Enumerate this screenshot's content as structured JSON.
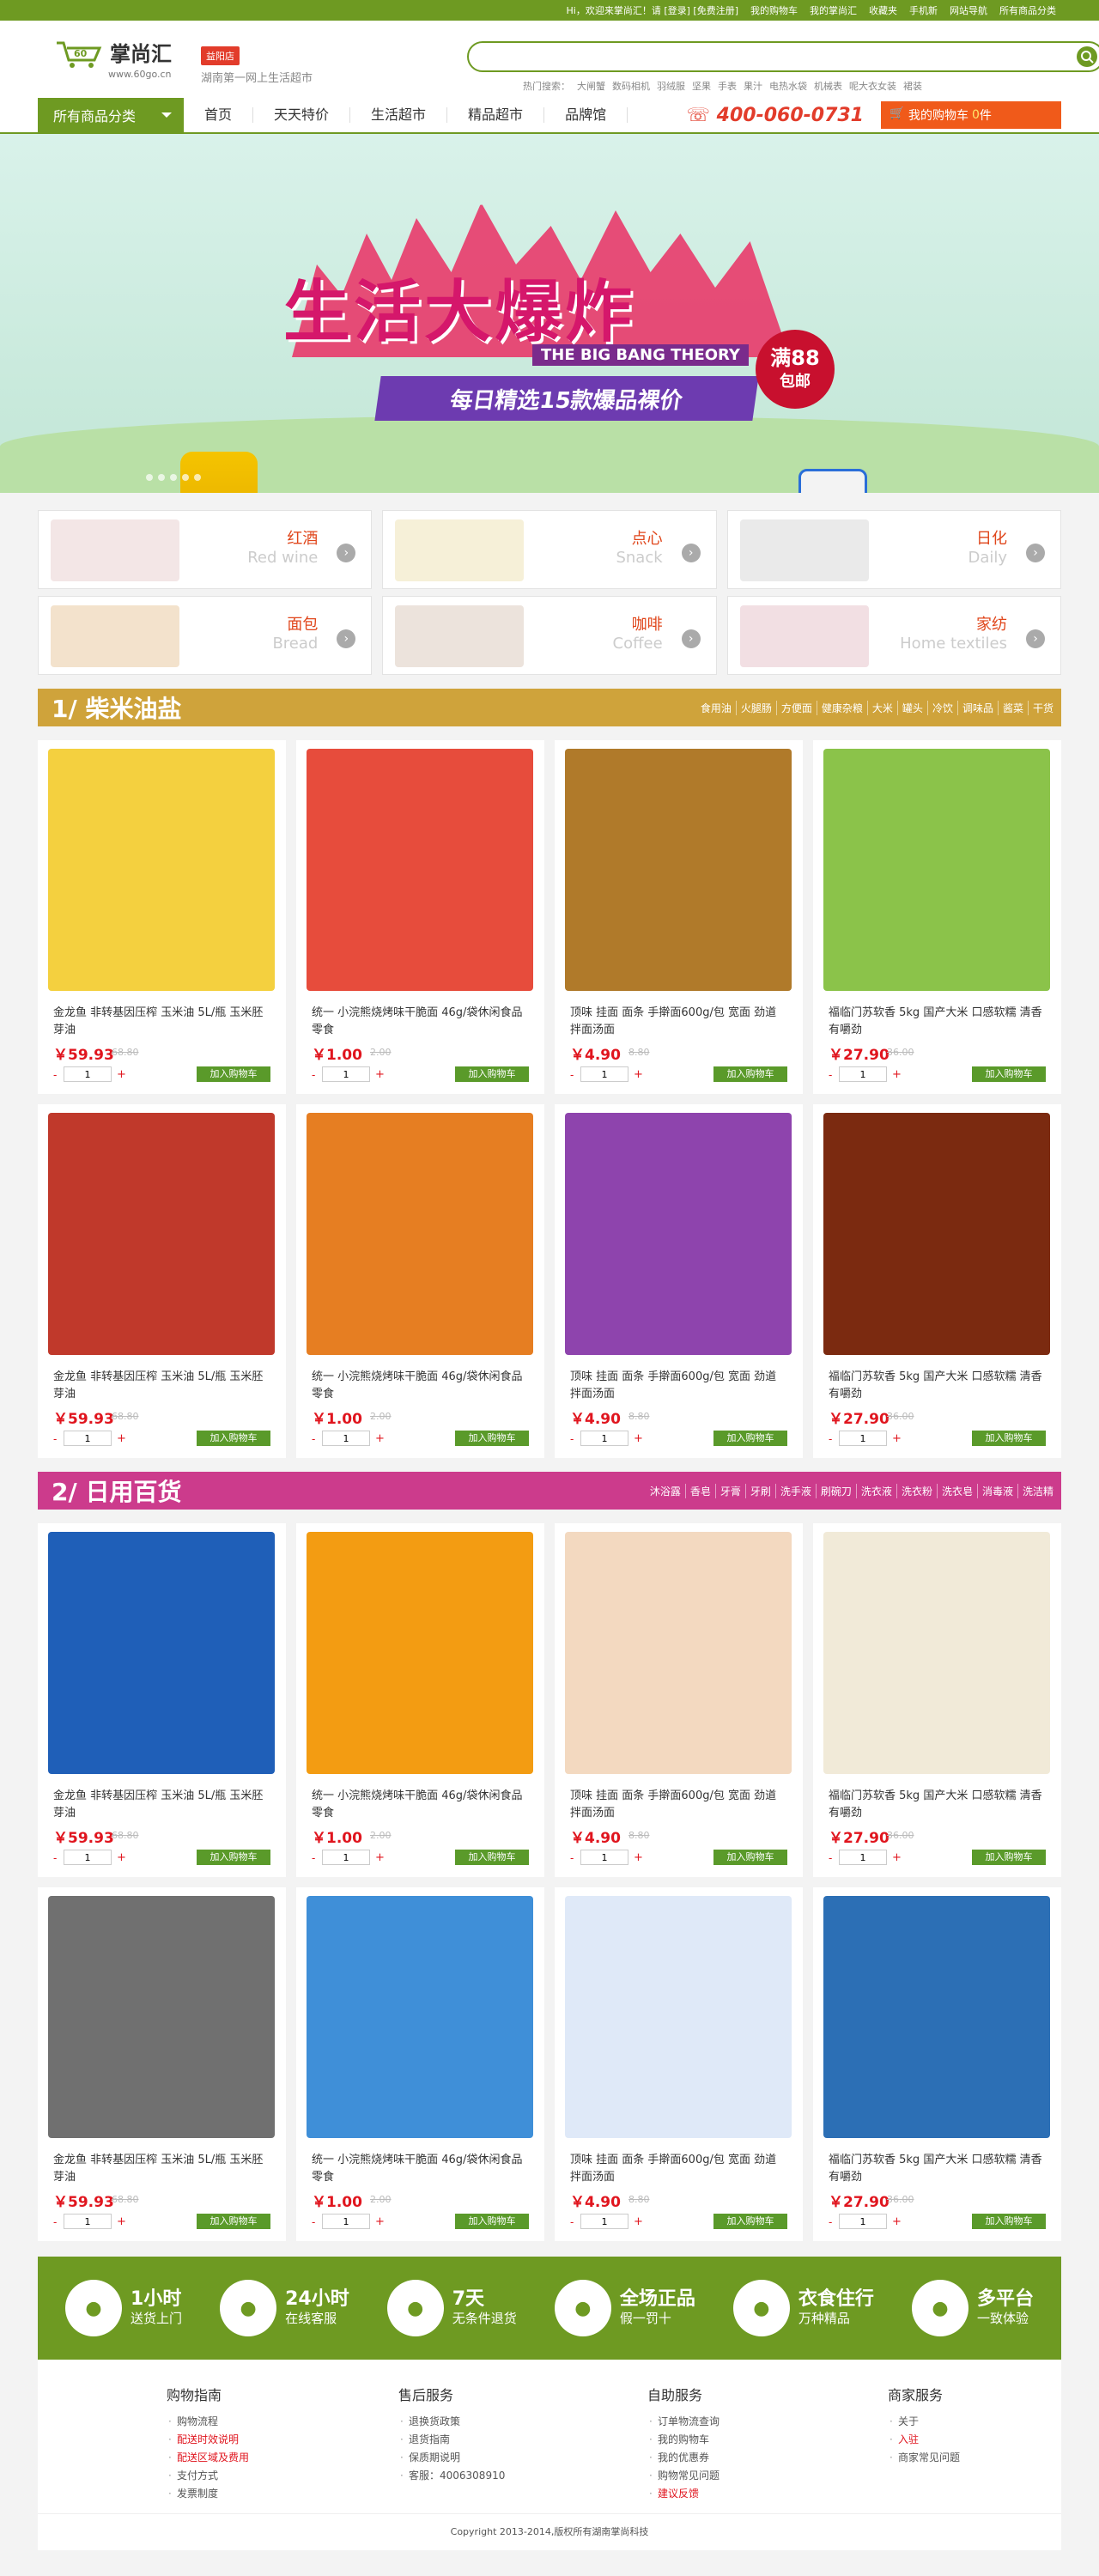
{
  "topbar": {
    "greeting": "Hi，欢迎来掌尚汇！请 [登录] [免费注册]",
    "links": [
      "我的购物车",
      "我的掌尚汇",
      "收藏夹",
      "手机新",
      "网站导航",
      "所有商品分类"
    ]
  },
  "header": {
    "logo_name": "掌尚汇",
    "logo_url": "www.60go.cn",
    "city_label": "益阳店",
    "slogan": "湖南第一网上生活超市",
    "search_placeholder": "",
    "hot_words": [
      "热门搜索：",
      "大闸蟹",
      "数码相机",
      "羽绒服",
      "坚果",
      "手表",
      "果汁",
      "电热水袋",
      "机械表",
      "呢大衣女装",
      "裙装"
    ]
  },
  "nav": {
    "all_label": "所有商品分类",
    "items": [
      "首页",
      "天天特价",
      "生活超市",
      "精品超市",
      "品牌馆"
    ],
    "phone": "400-060-0731",
    "cart_label": "我的购物车",
    "cart_count": "0",
    "cart_unit": "件"
  },
  "banner": {
    "title": "生活大爆炸",
    "subtitle": "THE BIG BANG THEORY",
    "slogan": "每日精选15款爆品裸价",
    "badge_top": "满88",
    "badge_bottom": "包邮"
  },
  "categories": [
    {
      "zh": "红酒",
      "en": "Red wine"
    },
    {
      "zh": "点心",
      "en": "Snack"
    },
    {
      "zh": "日化",
      "en": "Daily"
    },
    {
      "zh": "面包",
      "en": "Bread"
    },
    {
      "zh": "咖啡",
      "en": "Coffee"
    },
    {
      "zh": "家纺",
      "en": "Home textiles"
    }
  ],
  "sections": [
    {
      "title": "1/ 柴米油盐",
      "links": [
        "食用油",
        "火腿肠",
        "方便面",
        "健康杂粮",
        "大米",
        "罐头",
        "冷饮",
        "调味品",
        "酱菜",
        "干货"
      ]
    },
    {
      "title": "2/ 日用百货",
      "links": [
        "沐浴露",
        "香皂",
        "牙膏",
        "牙刷",
        "洗手液",
        "刷碗刀",
        "洗衣液",
        "洗衣粉",
        "洗衣皂",
        "消毒液",
        "洗洁精"
      ]
    }
  ],
  "products": [
    {
      "title": "金龙鱼 非转基因压榨 玉米油 5L/瓶 玉米胚芽油",
      "price": "￥59.93",
      "old": "68.80",
      "color": "#f4d03f"
    },
    {
      "title": "统一 小浣熊烧烤味干脆面 46g/袋休闲食品零食",
      "price": "￥1.00",
      "old": "2.00",
      "color": "#e74c3c"
    },
    {
      "title": "顶味 挂面 面条 手擀面600g/包 宽面 劲道拌面汤面",
      "price": "￥4.90",
      "old": "8.80",
      "color": "#b07a2a"
    },
    {
      "title": "福临门苏软香 5kg 国产大米 口感软糯 清香 有嚼劲",
      "price": "￥27.90",
      "old": "36.00",
      "color": "#8bc34a"
    },
    {
      "title": "金龙鱼 非转基因压榨 玉米油 5L/瓶 玉米胚芽油",
      "price": "￥59.93",
      "old": "68.80",
      "color": "#c0392b"
    },
    {
      "title": "统一 小浣熊烧烤味干脆面 46g/袋休闲食品零食",
      "price": "￥1.00",
      "old": "2.00",
      "color": "#e67e22"
    },
    {
      "title": "顶味 挂面 面条 手擀面600g/包 宽面 劲道拌面汤面",
      "price": "￥4.90",
      "old": "8.80",
      "color": "#8e44ad"
    },
    {
      "title": "福临门苏软香 5kg 国产大米 口感软糯 清香 有嚼劲",
      "price": "￥27.90",
      "old": "36.00",
      "color": "#7b2a10"
    },
    {
      "title": "金龙鱼 非转基因压榨 玉米油 5L/瓶 玉米胚芽油",
      "price": "￥59.93",
      "old": "68.80",
      "color": "#1f5fb8"
    },
    {
      "title": "统一 小浣熊烧烤味干脆面 46g/袋休闲食品零食",
      "price": "￥1.00",
      "old": "2.00",
      "color": "#f39c12"
    },
    {
      "title": "顶味 挂面 面条 手擀面600g/包 宽面 劲道拌面汤面",
      "price": "￥4.90",
      "old": "8.80",
      "color": "#f3d9c0"
    },
    {
      "title": "福临门苏软香 5kg 国产大米 口感软糯 清香 有嚼劲",
      "price": "￥27.90",
      "old": "36.00",
      "color": "#f1ead8"
    },
    {
      "title": "金龙鱼 非转基因压榨 玉米油 5L/瓶 玉米胚芽油",
      "price": "￥59.93",
      "old": "68.80",
      "color": "#707070"
    },
    {
      "title": "统一 小浣熊烧烤味干脆面 46g/袋休闲食品零食",
      "price": "￥1.00",
      "old": "2.00",
      "color": "#3f8fd8"
    },
    {
      "title": "顶味 挂面 面条 手擀面600g/包 宽面 劲道拌面汤面",
      "price": "￥4.90",
      "old": "8.80",
      "color": "#dfe9f8"
    },
    {
      "title": "福临门苏软香 5kg 国产大米 口感软糯 清香 有嚼劲",
      "price": "￥27.90",
      "old": "36.00",
      "color": "#2c6fb5"
    }
  ],
  "product_ui": {
    "qty": "1",
    "add_label": "加入购物车",
    "minus": "-",
    "plus": "+"
  },
  "services": [
    {
      "icon": "truck-icon",
      "big": "1小时",
      "small": "送货上门"
    },
    {
      "icon": "headset-icon",
      "big": "24小时",
      "small": "在线客服"
    },
    {
      "icon": "box-icon",
      "big": "7天",
      "small": "无条件退货"
    },
    {
      "icon": "shield-icon",
      "big": "全场正品",
      "small": "假一罚十"
    },
    {
      "icon": "bag-icon",
      "big": "衣食住行",
      "small": "万种精品"
    },
    {
      "icon": "monitor-icon",
      "big": "多平台",
      "small": "一致体验"
    }
  ],
  "footer": {
    "cols": [
      {
        "title": "购物指南",
        "items": [
          "购物流程",
          "配送时效说明",
          "配送区域及费用",
          "支付方式",
          "发票制度"
        ]
      },
      {
        "title": "售后服务",
        "items": [
          "退换货政策",
          "退货指南",
          "保质期说明",
          "客服：4006308910"
        ]
      },
      {
        "title": "自助服务",
        "items": [
          "订单物流查询",
          "我的购物车",
          "我的优惠券",
          "购物常见问题",
          "建议反馈"
        ]
      },
      {
        "title": "商家服务",
        "items": [
          "关于",
          "入驻",
          "商家常见问题"
        ]
      }
    ],
    "copyright": "Copyright 2013-2014,版权所有湖南掌尚科技"
  },
  "colors": {
    "brand": "#6e9a22",
    "accent": "#f05a1a",
    "price": "#e0151e",
    "sec1": "#cfa33b",
    "sec2": "#cc3b8c"
  }
}
